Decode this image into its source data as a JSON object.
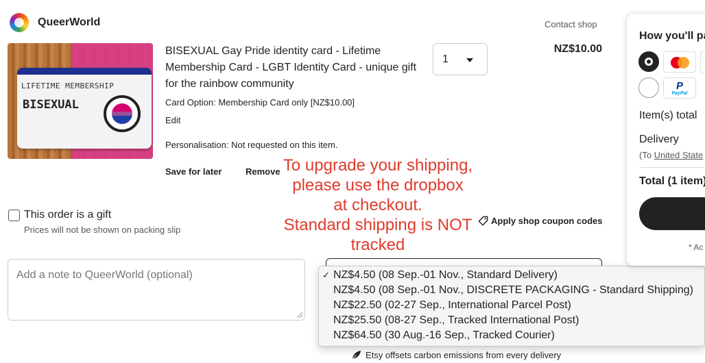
{
  "shop": {
    "name": "QueerWorld",
    "contact_label": "Contact shop"
  },
  "item": {
    "image_lines": [
      "LIFETIME MEMBERSHIP",
      "BISEXUAL"
    ],
    "title": "BISEXUAL Gay Pride identity card - Lifetime Membership Card - LGBT Identity Card - unique gift for the rainbow community",
    "option": "Card Option: Membership Card only [NZ$10.00]",
    "edit_label": "Edit",
    "personalisation": "Personalisation: Not requested on this item.",
    "save_later_label": "Save for later",
    "remove_label": "Remove",
    "quantity": "1",
    "price": "NZ$10.00"
  },
  "overlay_text": [
    "To upgrade your shipping,",
    "please use the dropbox",
    "at checkout.",
    "Standard shipping is NOT",
    "tracked"
  ],
  "gift": {
    "label": "This order is a gift",
    "note": "Prices will not be shown on packing slip"
  },
  "coupon_label": "Apply shop coupon codes",
  "note_placeholder": "Add a note to QueerWorld (optional)",
  "shipping": {
    "selected_index": 0,
    "options": [
      "NZ$4.50 (08 Sep.-01 Nov., Standard Delivery)",
      "NZ$4.50 (08 Sep.-01 Nov., DISCRETE PACKAGING - Standard Shipping)",
      "NZ$22.50 (02-27 Sep., International Parcel Post)",
      "NZ$25.50 (08-27 Sep., Tracked International Post)",
      "NZ$64.50 (30 Aug.-16 Sep., Tracked Courier)"
    ],
    "check_glyph": "✓"
  },
  "carbon_text": "Etsy offsets carbon emissions from every delivery",
  "payment": {
    "title": "How you'll pa",
    "paypal_logo": "P",
    "paypal_text": "PayPal",
    "items_total_label": "Item(s) total",
    "delivery_label": "Delivery",
    "delivery_to_prefix": "(To ",
    "delivery_to_link": "United State",
    "total_label": "Total (1 item)",
    "footnote": "* Ac"
  },
  "colors": {
    "overlay_red": "#e03b2b",
    "button_dark": "#222222"
  }
}
